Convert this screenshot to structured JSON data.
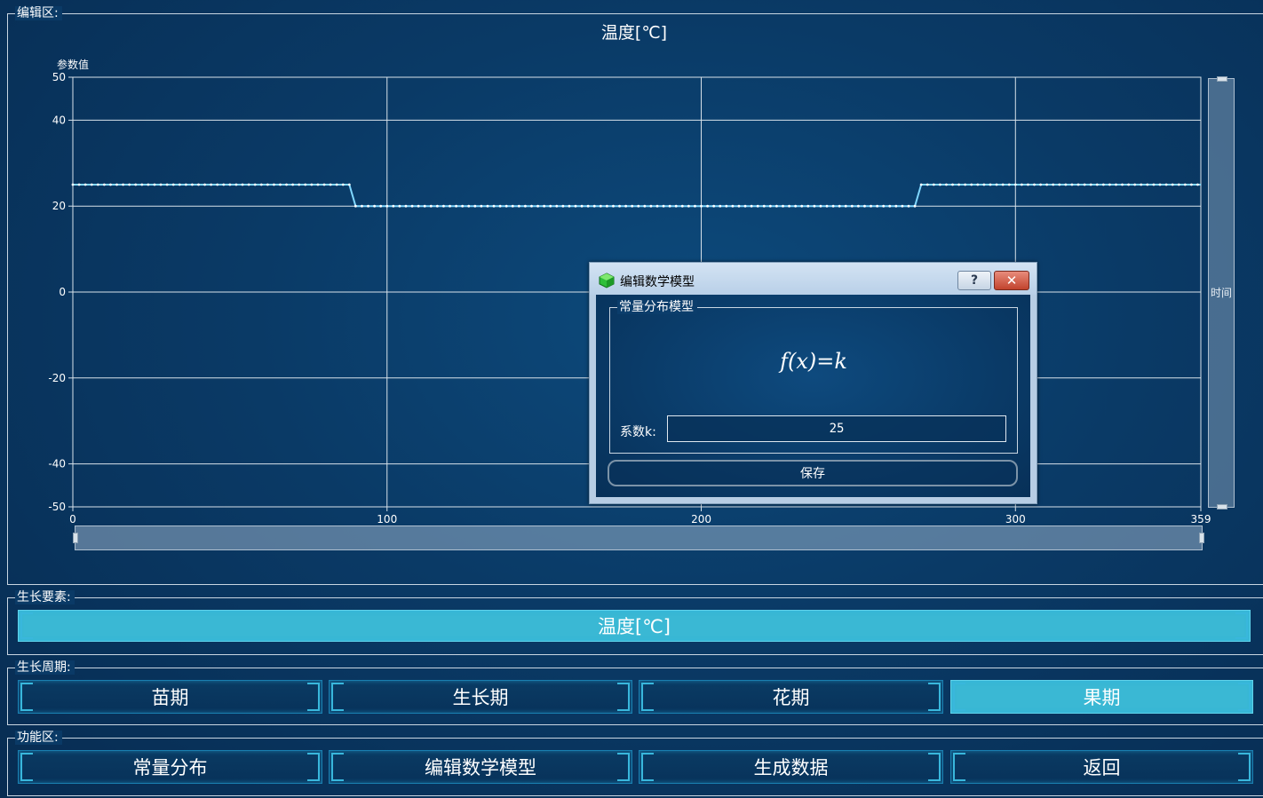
{
  "edit_area": {
    "title": "编辑区:",
    "chart_title": "温度[℃]",
    "y_axis_title": "参数值",
    "right_scroll_label": "时间"
  },
  "chart_data": {
    "type": "line",
    "title": "温度[℃]",
    "ylabel": "参数值",
    "xlim": [
      0,
      359
    ],
    "ylim": [
      -50,
      50
    ],
    "x_ticks": [
      0,
      100,
      200,
      300,
      359
    ],
    "y_ticks": [
      50,
      40,
      20,
      0,
      -20,
      -40,
      -50
    ],
    "grid": true,
    "series": [
      {
        "color": "#7fd7ff",
        "points": [
          [
            0,
            25
          ],
          [
            88,
            25
          ],
          [
            90,
            20
          ],
          [
            268,
            20
          ],
          [
            270,
            25
          ],
          [
            359,
            25
          ]
        ]
      }
    ]
  },
  "growth_element": {
    "title": "生长要素:",
    "button_label": "温度[℃]"
  },
  "growth_period": {
    "title": "生长周期:",
    "buttons": [
      "苗期",
      "生长期",
      "花期",
      "果期"
    ],
    "active_index": 3
  },
  "function_area": {
    "title": "功能区:",
    "buttons": [
      "常量分布",
      "编辑数学模型",
      "生成数据",
      "返回"
    ]
  },
  "dialog": {
    "title": "编辑数学模型",
    "help_label": "?",
    "close_label": "✕",
    "group_title": "常量分布模型",
    "formula": "f(x)=k",
    "coef_label": "系数k:",
    "coef_value": "25",
    "save_label": "保存"
  },
  "icons": {
    "dialog_app_icon": "green-cube-icon",
    "help_icon": "question-icon",
    "close_icon": "close-icon"
  }
}
